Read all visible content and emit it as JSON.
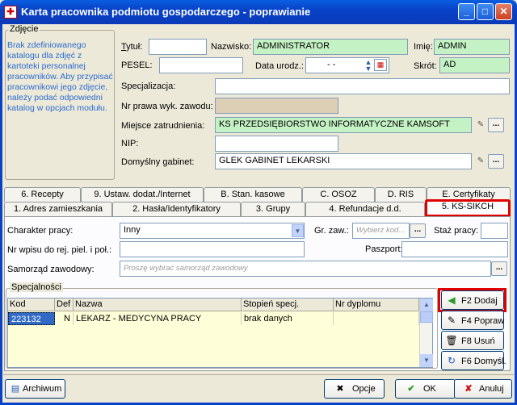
{
  "window": {
    "title": "Karta pracownika podmiotu gospodarczego - poprawianie",
    "app_icon": "medical-card-icon",
    "controls": [
      "minimize-icon",
      "maximize-icon",
      "close-icon"
    ]
  },
  "photo": {
    "group_label": "Zdjęcie",
    "message": "Brak zdefiniowanego katalogu dla zdjęć z kartoteki personalnej pracowników. Aby przypisać pracownikowi jego zdjęcie, należy podać odpowiedni katalog w opcjach modułu."
  },
  "form": {
    "tytul_label": "Tytuł:",
    "tytul_value": "",
    "nazwisko_label": "Nazwisko:",
    "nazwisko_value": "ADMINISTRATOR",
    "imie_label": "Imię:",
    "imie_value": "ADMIN",
    "pesel_label": "PESEL:",
    "pesel_value": "",
    "data_label": "Data urodz.:",
    "data_value": "-   -",
    "skrot_label": "Skrót:",
    "skrot_value": "AD",
    "specjalizacja_label": "Specjalizacja:",
    "specjalizacja_value": "",
    "prawo_label": "Nr prawa wyk. zawodu:",
    "prawo_value": "",
    "miejsce_label": "Miejsce zatrudnienia:",
    "miejsce_value": "KS PRZEDSIĘBIORSTWO INFORMATYCZNE KAMSOFT",
    "nip_label": "NIP:",
    "nip_value": "",
    "gabinet_label": "Domyślny gabinet:",
    "gabinet_value": "GLEK GABINET LEKARSKI"
  },
  "tabs_row1": [
    "6. Recepty",
    "9. Ustaw. dodat./Internet",
    "B. Stan. kasowe",
    "C. OSOZ",
    "D. RIS",
    "E. Certyfikaty"
  ],
  "tabs_row2": [
    "1. Adres zamieszkania",
    "2. Hasła/Identyfikatory",
    "3. Grupy",
    "4. Refundacje d.d.",
    "5. KS-SIKCH"
  ],
  "tab_panel": {
    "charakter_label": "Charakter pracy:",
    "charakter_value": "Inny",
    "grzaw_label": "Gr. zaw.:",
    "grzaw_placeholder": "Wybierz kod...",
    "staz_label": "Staż pracy:",
    "staz_value": "",
    "wpis_label": "Nr wpisu do rej. piel. i poł.:",
    "wpis_value": "",
    "paszport_label": "Paszport:",
    "paszport_value": "",
    "samorzad_label": "Samorząd zawodowy:",
    "samorzad_placeholder": "Proszę wybrać samorząd zawodowy",
    "spec_group_label": "Specjalności",
    "table": {
      "headers": [
        "Kod",
        "Def",
        "Nazwa",
        "Stopień specj.",
        "Nr dyplomu"
      ],
      "rows": [
        [
          "223132",
          "N",
          "LEKARZ - MEDYCYNA PRACY",
          "brak danych",
          ""
        ]
      ]
    },
    "buttons": {
      "add": "F2 Dodaj",
      "edit": "F4 Popraw",
      "delete": "F8 Usuń",
      "default": "F6 Domyśl."
    }
  },
  "footer": {
    "archive": "Archiwum",
    "options": "Opcje",
    "ok": "OK",
    "cancel": "Anuluj"
  },
  "colors": {
    "title_blue": "#0842c8",
    "green_field": "#c4f2c4",
    "highlight_red": "#e00000",
    "grid_yellow": "#fefed8"
  }
}
